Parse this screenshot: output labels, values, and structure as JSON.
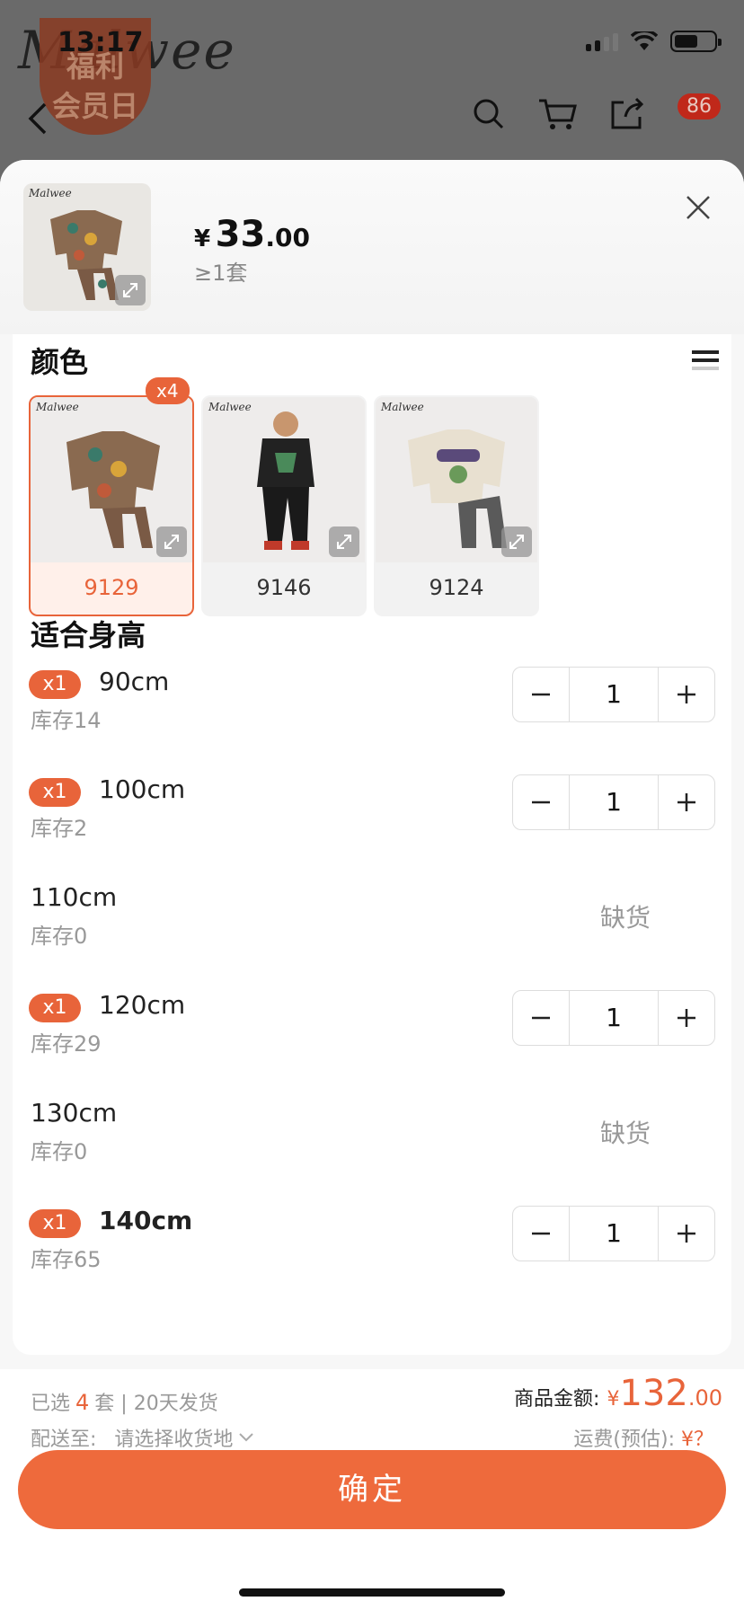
{
  "status": {
    "time": "13:17"
  },
  "background": {
    "logo": "Malwee",
    "badge": "福利\n会员日",
    "cart_count": "86"
  },
  "product": {
    "price_currency": "¥",
    "price_int": "33",
    "price_dec": ".00",
    "moq": "≥1套",
    "thumb_brand": "Malwee"
  },
  "color": {
    "title": "颜色",
    "options": [
      {
        "label": "9129",
        "selected": true,
        "badge": "x4"
      },
      {
        "label": "9146",
        "selected": false
      },
      {
        "label": "9124",
        "selected": false
      }
    ]
  },
  "height": {
    "title": "适合身高",
    "rows": [
      {
        "tag": "x1",
        "size": "90cm",
        "stock": "库存14",
        "qty": "1"
      },
      {
        "tag": "x1",
        "size": "100cm",
        "stock": "库存2",
        "qty": "1"
      },
      {
        "size": "110cm",
        "stock": "库存0",
        "oos": "缺货"
      },
      {
        "tag": "x1",
        "size": "120cm",
        "stock": "库存29",
        "qty": "1"
      },
      {
        "size": "130cm",
        "stock": "库存0",
        "oos": "缺货"
      },
      {
        "tag": "x1",
        "size": "140cm",
        "stock": "库存65",
        "qty": "1"
      }
    ]
  },
  "footer": {
    "selected_prefix": "已选",
    "selected_count": "4",
    "selected_suffix": "套 | 20天发货",
    "ship_to_label": "配送至:",
    "ship_to_value": "请选择收货地",
    "amount_label": "商品金额:",
    "amount_currency": "¥",
    "amount_int": "132",
    "amount_dec": ".00",
    "freight_label": "运费(预估):",
    "freight_value": "¥？",
    "confirm": "确定"
  },
  "colors": {
    "accent": "#ee6a3c"
  }
}
